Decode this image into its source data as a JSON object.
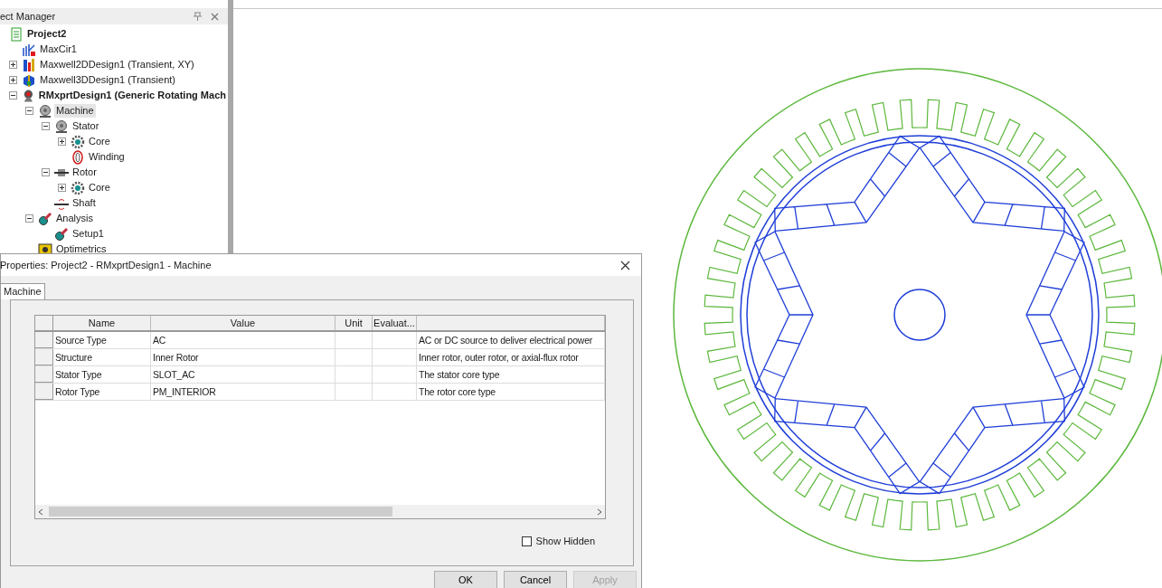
{
  "project_manager": {
    "title": "ect Manager",
    "tree": [
      {
        "label": "Project2",
        "kind": "project",
        "active": true,
        "selected": false,
        "children": [
          {
            "label": "MaxCir1",
            "kind": "circuit",
            "active": false,
            "selected": false
          },
          {
            "label": "Maxwell2DDesign1 (Transient, XY)",
            "kind": "design2d",
            "active": false,
            "selected": false,
            "expanded": false
          },
          {
            "label": "Maxwell3DDesign1 (Transient)",
            "kind": "design3d",
            "active": false,
            "selected": false,
            "expanded": false
          },
          {
            "label": "RMxprtDesign1 (Generic Rotating Mach",
            "kind": "rmxprt",
            "active": true,
            "selected": false,
            "expanded": true,
            "children": [
              {
                "label": "Machine",
                "kind": "machine",
                "active": false,
                "selected": true,
                "expanded": true,
                "children": [
                  {
                    "label": "Stator",
                    "kind": "stator",
                    "active": false,
                    "selected": false,
                    "expanded": true,
                    "children": [
                      {
                        "label": "Core",
                        "kind": "core",
                        "active": false,
                        "selected": false,
                        "expanded": false
                      },
                      {
                        "label": "Winding",
                        "kind": "winding",
                        "active": false,
                        "selected": false
                      }
                    ]
                  },
                  {
                    "label": "Rotor",
                    "kind": "rotor",
                    "active": false,
                    "selected": false,
                    "expanded": true,
                    "children": [
                      {
                        "label": "Core",
                        "kind": "core",
                        "active": false,
                        "selected": false,
                        "expanded": false
                      }
                    ]
                  },
                  {
                    "label": "Shaft",
                    "kind": "shaft",
                    "active": false,
                    "selected": false
                  }
                ]
              },
              {
                "label": "Analysis",
                "kind": "analysis",
                "active": false,
                "selected": false,
                "expanded": true,
                "children": [
                  {
                    "label": "Setup1",
                    "kind": "setup",
                    "active": false,
                    "selected": false
                  }
                ]
              },
              {
                "label": "Optimetrics",
                "kind": "optimetrics",
                "active": false,
                "selected": false
              }
            ]
          }
        ]
      }
    ]
  },
  "dialog": {
    "title": "Properties: Project2 - RMxprtDesign1 - Machine",
    "tabs": [
      {
        "label": "Machine",
        "selected": true
      }
    ],
    "table": {
      "columns": [
        "Name",
        "Value",
        "Unit",
        "Evaluat...",
        ""
      ],
      "rows": [
        [
          "Source Type",
          "AC",
          "",
          "",
          "AC or DC source to deliver electrical power"
        ],
        [
          "Structure",
          "Inner Rotor",
          "",
          "",
          "Inner rotor, outer rotor, or axial-flux rotor"
        ],
        [
          "Stator Type",
          "SLOT_AC",
          "",
          "",
          "The stator core type"
        ],
        [
          "Rotor Type",
          "PM_INTERIOR",
          "",
          "",
          "The rotor core type"
        ]
      ]
    },
    "show_hidden": {
      "label": "Show Hidden",
      "checked": false
    },
    "buttons": [
      {
        "label": "OK",
        "disabled": false
      },
      {
        "label": "Cancel",
        "disabled": false
      },
      {
        "label": "Apply",
        "disabled": true
      }
    ]
  }
}
